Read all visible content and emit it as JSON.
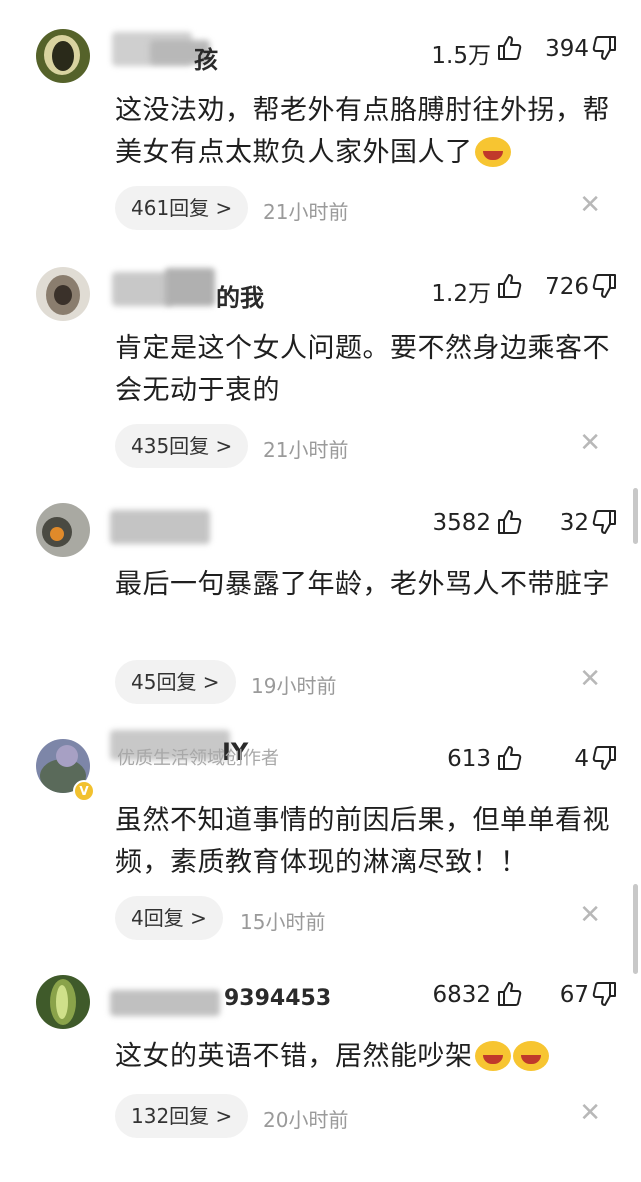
{
  "comments": [
    {
      "name_suffix": "孩",
      "likes": "1.5万",
      "dislikes": "394",
      "text": "这没法劝，帮老外有点胳膊肘往外拐，帮美女有点太欺负人家外国人了",
      "replies": "461回复 >",
      "time": "21小时前"
    },
    {
      "name_suffix": "的我",
      "likes": "1.2万",
      "dislikes": "726",
      "text": "肯定是这个女人问题。要不然身边乘客不会无动于衷的",
      "replies": "435回复 >",
      "time": "21小时前"
    },
    {
      "name_suffix": "",
      "likes": "3582",
      "dislikes": "32",
      "text": "最后一句暴露了年龄，老外骂人不带脏字",
      "replies": "45回复 >",
      "time": "19小时前"
    },
    {
      "name_suffix": "IY",
      "creator_label": "优质生活领域创作者",
      "likes": "613",
      "dislikes": "4",
      "text": "虽然不知道事情的前因后果，但单单看视频，素质教育体现的淋漓尽致！！",
      "replies": "4回复 >",
      "time": "15小时前"
    },
    {
      "name_suffix": "9394453",
      "likes": "6832",
      "dislikes": "67",
      "text": "这女的英语不错，居然能吵架",
      "replies": "132回复 >",
      "time": "20小时前"
    }
  ],
  "icons": {
    "like": "thumbs-up-icon",
    "dislike": "thumbs-down-icon",
    "close": "close-icon",
    "emoji_cry_laugh": "crying-laughing-emoji",
    "emoji_grin": "grinning-emoji",
    "verified_badge": "v-badge-icon"
  },
  "colors": {
    "text": "#1f1f1f",
    "meta": "#9a9a9a",
    "reply_bg": "#f2f2f2",
    "badge": "#f2c12e"
  }
}
